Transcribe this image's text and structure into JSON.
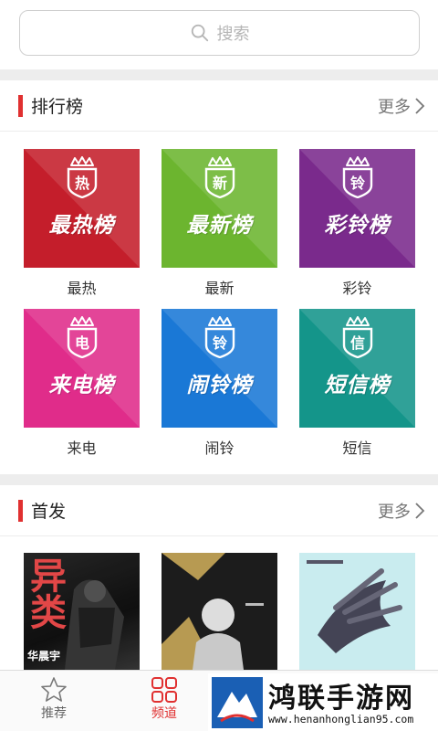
{
  "search": {
    "placeholder": "搜索"
  },
  "rank_section": {
    "title": "排行榜",
    "more": "更多",
    "tiles": [
      {
        "label": "最热",
        "badge": "热",
        "art_text": "最热榜",
        "color": "#c41e2b"
      },
      {
        "label": "最新",
        "badge": "新",
        "art_text": "最新榜",
        "color": "#6cb52f"
      },
      {
        "label": "彩铃",
        "badge": "铃",
        "art_text": "彩铃榜",
        "color": "#7a2a8c"
      },
      {
        "label": "来电",
        "badge": "电",
        "art_text": "来电榜",
        "color": "#e02c8a"
      },
      {
        "label": "闹铃",
        "badge": "铃",
        "art_text": "闹铃榜",
        "color": "#1a78d6"
      },
      {
        "label": "短信",
        "badge": "信",
        "art_text": "短信榜",
        "color": "#14958a"
      }
    ]
  },
  "first_section": {
    "title": "首发",
    "more": "更多",
    "albums": [
      {
        "text": "华晨宇",
        "big": "异类"
      },
      {
        "text": ""
      },
      {
        "text": ""
      }
    ]
  },
  "tabbar": {
    "tabs": [
      {
        "label": "推荐",
        "icon": "star-icon",
        "active": false
      },
      {
        "label": "频道",
        "icon": "grid-icon",
        "active": true
      }
    ]
  },
  "watermark": {
    "title": "鸿联手游网",
    "url": "www.henanhonglian95.com"
  }
}
